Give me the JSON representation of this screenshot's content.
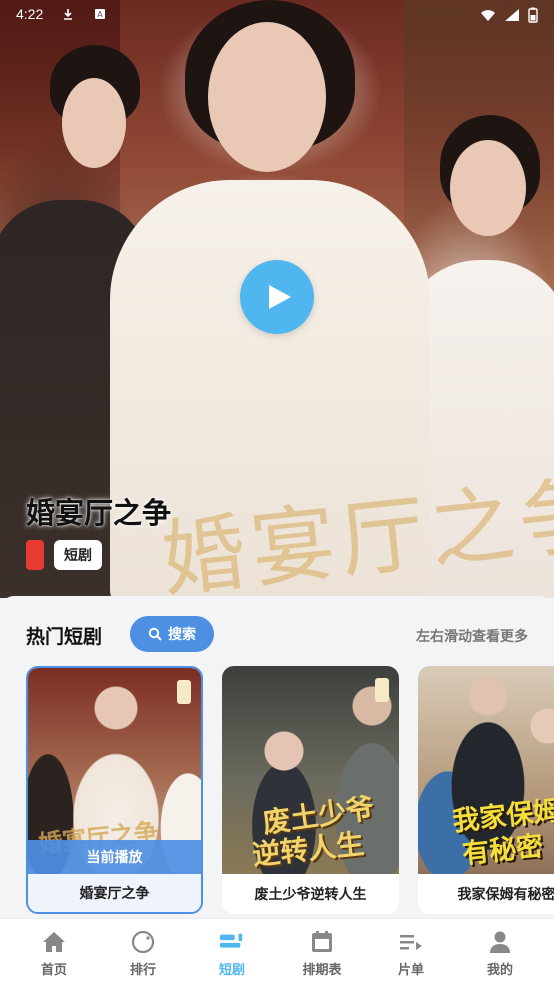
{
  "status_bar": {
    "time": "4:22"
  },
  "hero": {
    "title": "婚宴厅之争",
    "overlay_text": "婚宴厅之争",
    "tag": "短剧",
    "play_color": "#4fb6ef"
  },
  "section": {
    "title": "热门短剧",
    "search_label": "搜索",
    "more_hint": "左右滑动查看更多"
  },
  "cards": [
    {
      "title": "婚宴厅之争",
      "status": "当前播放",
      "poster_text": [
        "婚宴厅之争"
      ]
    },
    {
      "title": "废土少爷逆转人生",
      "poster_text": [
        "废土少爷",
        "逆转人生"
      ]
    },
    {
      "title": "我家保姆有秘密",
      "poster_text": [
        "我家保姆",
        "有秘密"
      ]
    }
  ],
  "tabs": [
    {
      "label": "首页",
      "icon": "home-icon"
    },
    {
      "label": "排行",
      "icon": "circle-icon"
    },
    {
      "label": "短剧",
      "icon": "short-video-icon",
      "active": true
    },
    {
      "label": "排期表",
      "icon": "calendar-icon"
    },
    {
      "label": "片单",
      "icon": "playlist-icon"
    },
    {
      "label": "我的",
      "icon": "user-icon"
    }
  ],
  "colors": {
    "accent": "#4fb6ef",
    "search_button": "#4d8fe3",
    "tag_red": "#e83a35"
  }
}
